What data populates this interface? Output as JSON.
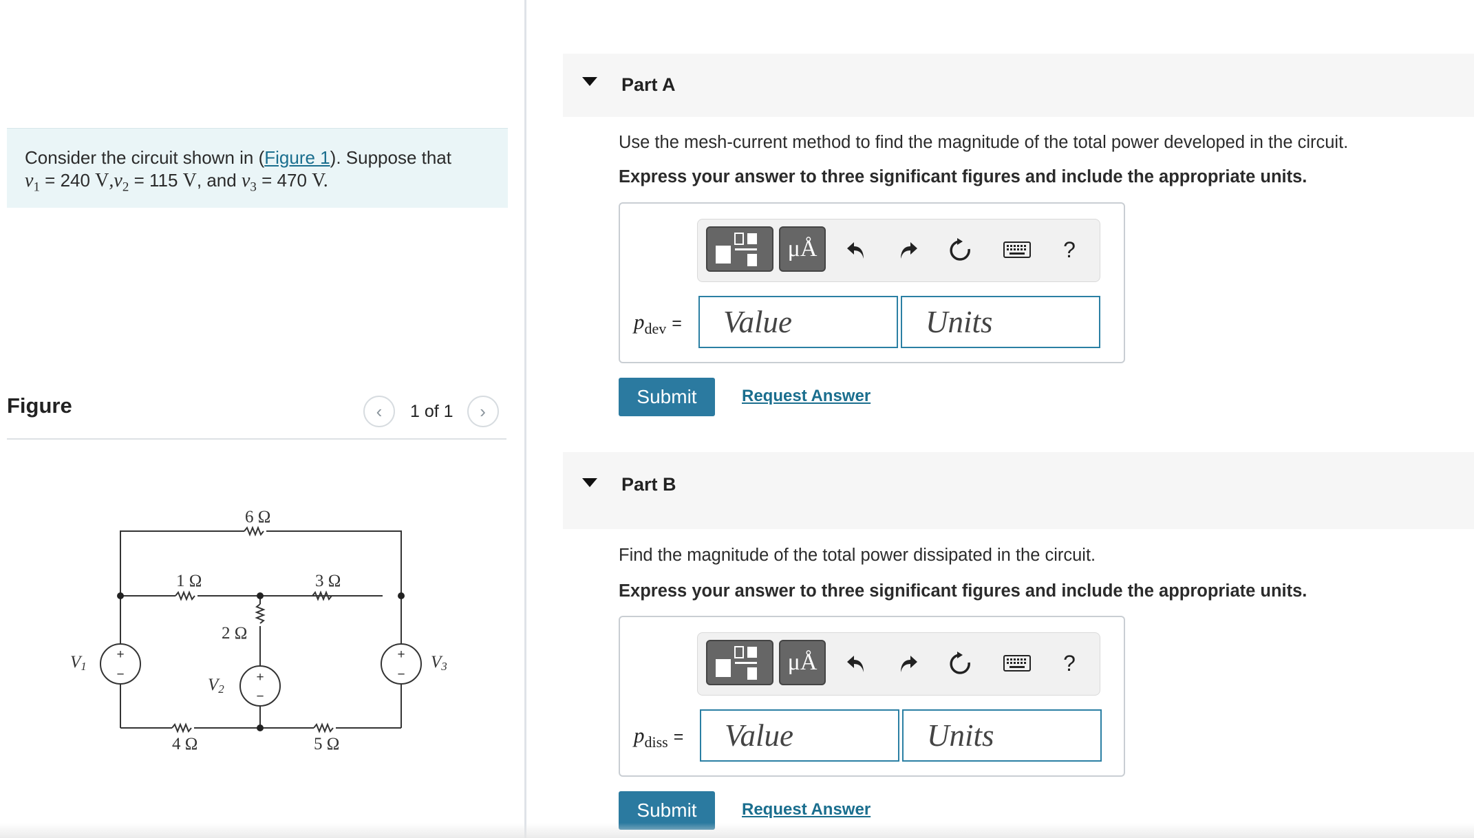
{
  "problem": {
    "intro": "Consider the circuit shown in (",
    "figure_link": "Figure 1",
    "intro_end": "). Suppose that",
    "v1_sym": "v",
    "v1_sub": "1",
    "v1_val": " = 240 ",
    "v1_unit": "V",
    "v2_sym": ",v",
    "v2_sub": "2",
    "v2_val": " = 115 ",
    "v2_unit": "V",
    "and": ", and ",
    "v3_sym": "v",
    "v3_sub": "3",
    "v3_val": " = 470 ",
    "v3_unit": "V."
  },
  "figure": {
    "title": "Figure",
    "count": "1 of 1",
    "prev_icon": "chevron-left-icon",
    "next_icon": "chevron-right-icon",
    "labels": {
      "r6": "6 Ω",
      "r1": "1 Ω",
      "r3": "3 Ω",
      "r2": "2 Ω",
      "r4": "4 Ω",
      "r5": "5 Ω",
      "v1": "V",
      "v1_sub": "1",
      "v2": "V",
      "v2_sub": "2",
      "v3": "V",
      "v3_sub": "3",
      "plus": "+",
      "minus": "−"
    }
  },
  "parts": [
    {
      "title": "Part A",
      "question": "Use the mesh-current method to find the magnitude of the total power developed in the circuit.",
      "instruction": "Express your answer to three significant figures and include the appropriate units.",
      "var": "p",
      "var_sub": "dev",
      "eq": "=",
      "value_placeholder": "Value",
      "units_placeholder": "Units",
      "submit": "Submit",
      "request": "Request Answer"
    },
    {
      "title": "Part B",
      "question": "Find the magnitude of the total power dissipated in the circuit.",
      "instruction": "Express your answer to three significant figures and include the appropriate units.",
      "var": "p",
      "var_sub": "diss",
      "eq": "=",
      "value_placeholder": "Value",
      "units_placeholder": "Units",
      "submit": "Submit",
      "request": "Request Answer"
    }
  ],
  "toolbar": {
    "units_btn": "μÅ",
    "help": "?",
    "icons": [
      "templates-icon",
      "units-icon",
      "undo-icon",
      "redo-icon",
      "reset-icon",
      "keyboard-icon",
      "help-icon"
    ]
  },
  "colors": {
    "accent": "#2b7aa0",
    "link": "#1a6e8e",
    "problem_bg": "#eaf5f7"
  }
}
